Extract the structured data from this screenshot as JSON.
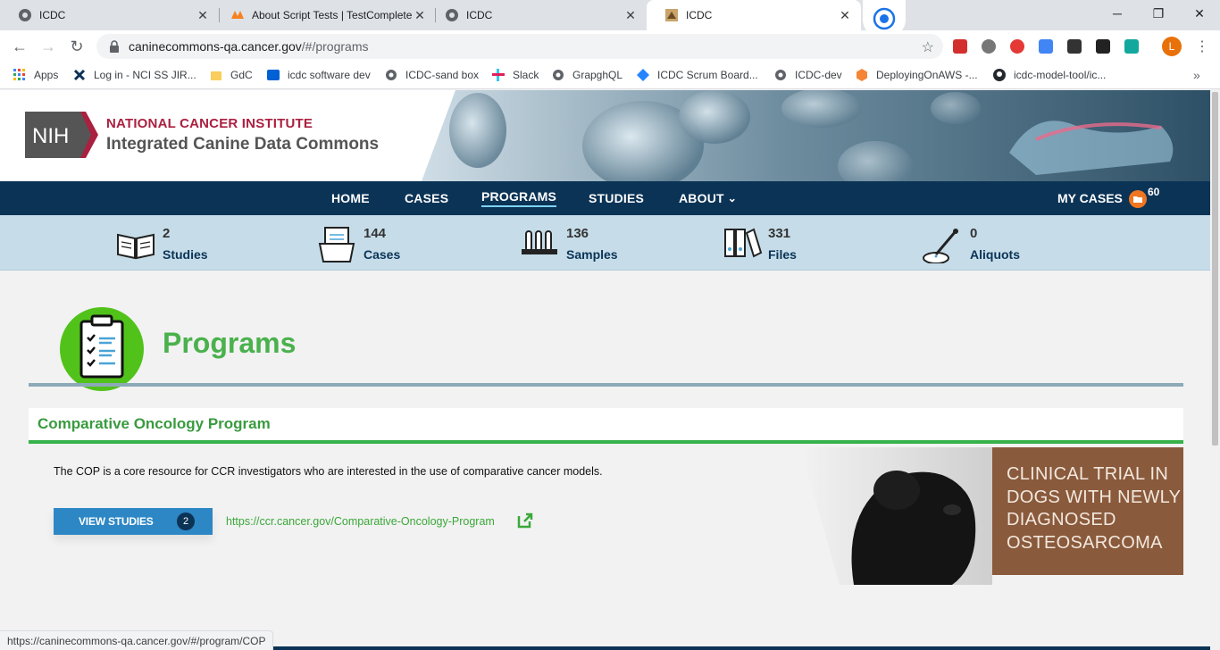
{
  "browser": {
    "tabs": [
      {
        "title": "ICDC",
        "icon": "globe-icon",
        "active": false
      },
      {
        "title": "About Script Tests | TestComplete",
        "icon": "testcomplete-icon",
        "active": false
      },
      {
        "title": "ICDC",
        "icon": "globe-icon",
        "active": false
      },
      {
        "title": "ICDC",
        "icon": "icdc-favicon",
        "active": true
      }
    ],
    "url_host": "caninecommons-qa.cancer.gov",
    "url_path": "/#/programs",
    "profile_initial": "L",
    "bookmarks": [
      {
        "label": "Apps",
        "icon": "apps-grid-icon"
      },
      {
        "label": "Log in - NCI SS JIR...",
        "icon": "jira-icon"
      },
      {
        "label": "GdC",
        "icon": "folder-icon"
      },
      {
        "label": "icdc software dev",
        "icon": "box-icon"
      },
      {
        "label": "ICDC-sand box",
        "icon": "globe-icon"
      },
      {
        "label": "Slack",
        "icon": "slack-icon"
      },
      {
        "label": "GrapghQL",
        "icon": "globe-icon"
      },
      {
        "label": "ICDC Scrum Board...",
        "icon": "jira-diamond-icon"
      },
      {
        "label": "ICDC-dev",
        "icon": "globe-icon"
      },
      {
        "label": "DeployingOnAWS -...",
        "icon": "aws-icon"
      },
      {
        "label": "icdc-model-tool/ic...",
        "icon": "github-icon"
      }
    ],
    "status_url": "https://caninecommons-qa.cancer.gov/#/program/COP"
  },
  "site": {
    "org_name": "NATIONAL CANCER INSTITUTE",
    "site_name": "Integrated Canine Data Commons",
    "logo_text": "NIH"
  },
  "nav": {
    "items": [
      {
        "label": "HOME",
        "active": false
      },
      {
        "label": "CASES",
        "active": false
      },
      {
        "label": "PROGRAMS",
        "active": true
      },
      {
        "label": "STUDIES",
        "active": false
      },
      {
        "label": "ABOUT",
        "active": false
      }
    ],
    "about_caret": "⌄",
    "my_cases_label": "MY CASES",
    "my_cases_count": "60"
  },
  "stats": [
    {
      "value": "2",
      "label": "Studies",
      "icon": "book-icon"
    },
    {
      "value": "144",
      "label": "Cases",
      "icon": "case-folder-icon"
    },
    {
      "value": "136",
      "label": "Samples",
      "icon": "test-tubes-icon"
    },
    {
      "value": "331",
      "label": "Files",
      "icon": "binders-icon"
    },
    {
      "value": "0",
      "label": "Aliquots",
      "icon": "pipette-dish-icon"
    }
  ],
  "page": {
    "title": "Programs"
  },
  "program": {
    "name": "Comparative Oncology Program",
    "description": "The COP is a core resource for CCR investigators who are interested in the use of comparative cancer models.",
    "view_button_label": "VIEW STUDIES",
    "study_count": "2",
    "link": "https://ccr.cancer.gov/Comparative-Oncology-Program",
    "image_caption_lines": [
      "CLINICAL TRIAL IN",
      "DOGS WITH NEWLY",
      "DIAGNOSED",
      "OSTEOSARCOMA"
    ]
  },
  "colors": {
    "nav_bg": "#0b3356",
    "stats_bg": "#c6dde9",
    "accent_green": "#4ab14d",
    "button_blue": "#2d87c5",
    "nci_red": "#ab2040",
    "cart_orange": "#f07622"
  }
}
